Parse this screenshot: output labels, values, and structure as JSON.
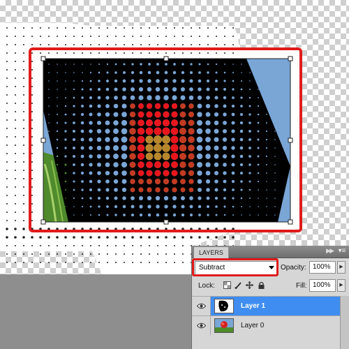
{
  "layers_panel": {
    "tab_label": "LAYERS",
    "collapse_icon": "double-chevron-right-icon",
    "menu_icon": "panel-menu-icon",
    "blend_mode": "Subtract",
    "opacity_label": "Opacity:",
    "opacity_value": "100%",
    "lock_label": "Lock:",
    "lock_icons": [
      "lock-transparency-icon",
      "lock-image-pixels-icon",
      "lock-position-icon",
      "lock-all-icon"
    ],
    "fill_label": "Fill:",
    "fill_value": "100%",
    "layers": [
      {
        "name": "Layer 1",
        "visible": true,
        "selected": true
      },
      {
        "name": "Layer 0",
        "visible": true,
        "selected": false
      }
    ]
  },
  "colors": {
    "highlight_red": "#e01b1b",
    "selected_layer_blue": "#3f8df0",
    "sky_blue": "#7aa6d6"
  }
}
